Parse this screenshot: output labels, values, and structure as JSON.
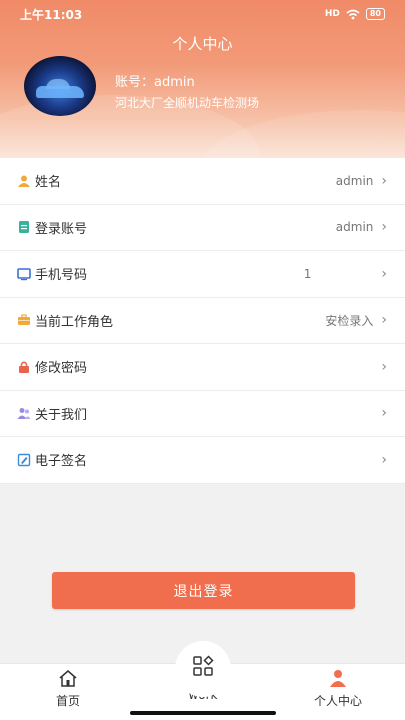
{
  "status_bar": {
    "time": "上午11:03",
    "signal": "HD",
    "battery": "80"
  },
  "header": {
    "title": "个人中心",
    "account": "账号：admin",
    "company": "河北大厂全顺机动车检测场"
  },
  "list": [
    {
      "label": "姓名",
      "value": "admin",
      "icon": "user-icon"
    },
    {
      "label": "登录账号",
      "value": "admin",
      "icon": "document-icon"
    },
    {
      "label": "手机号码",
      "value": "1",
      "icon": "monitor-icon"
    },
    {
      "label": "当前工作角色",
      "value": "安检录入",
      "icon": "briefcase-icon"
    },
    {
      "label": "修改密码",
      "value": "",
      "icon": "lock-icon"
    },
    {
      "label": "关于我们",
      "value": "",
      "icon": "group-icon"
    },
    {
      "label": "电子签名",
      "value": "",
      "icon": "signature-icon"
    }
  ],
  "logout_label": "退出登录",
  "tabs": [
    {
      "label": "首页",
      "icon": "home-icon"
    },
    {
      "label": "work",
      "icon": "grid-icon"
    },
    {
      "label": "个人中心",
      "icon": "person-icon"
    }
  ],
  "colors": {
    "accent": "#f06e4d",
    "header": "#f08a67"
  }
}
